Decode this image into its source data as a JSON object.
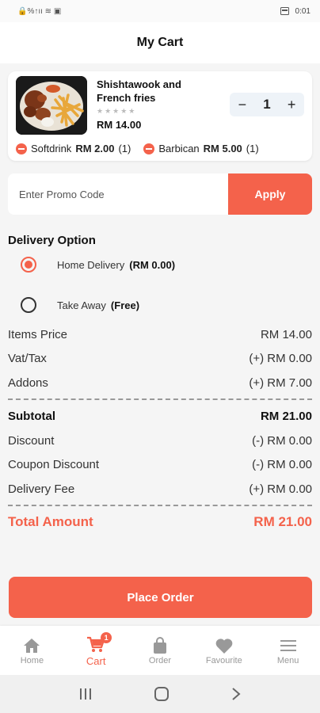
{
  "status_bar": {
    "left_icons": "🔒%↑ıı ≋ ▣",
    "time": "0:01"
  },
  "header": {
    "title": "My Cart"
  },
  "cart_item": {
    "name": "Shishtawook and French fries",
    "rating": "★★★★★",
    "price": "RM 14.00",
    "quantity": "1",
    "addons": [
      {
        "name": "Softdrink",
        "price": "RM 2.00",
        "qty": "(1)"
      },
      {
        "name": "Barbican",
        "price": "RM 5.00",
        "qty": "(1)"
      }
    ]
  },
  "promo": {
    "placeholder": "Enter Promo Code",
    "apply_label": "Apply"
  },
  "delivery": {
    "title": "Delivery Option",
    "options": [
      {
        "label": "Home Delivery",
        "sub": "(RM 0.00)",
        "selected": true
      },
      {
        "label": "Take Away",
        "sub": "(Free)",
        "selected": false
      }
    ]
  },
  "summary": {
    "items_price": {
      "label": "Items Price",
      "value": "RM 14.00"
    },
    "vat": {
      "label": "Vat/Tax",
      "value": "(+) RM 0.00"
    },
    "addons": {
      "label": "Addons",
      "value": "(+) RM 7.00"
    },
    "subtotal": {
      "label": "Subtotal",
      "value": "RM 21.00"
    },
    "discount": {
      "label": "Discount",
      "value": "(-) RM 0.00"
    },
    "coupon": {
      "label": "Coupon Discount",
      "value": "(-) RM 0.00"
    },
    "delivery_fee": {
      "label": "Delivery Fee",
      "value": "(+) RM 0.00"
    },
    "total": {
      "label": "Total Amount",
      "value": "RM 21.00"
    }
  },
  "place_order_label": "Place Order",
  "nav": [
    {
      "label": "Home",
      "icon": "home-icon"
    },
    {
      "label": "Cart",
      "icon": "cart-icon",
      "badge": "1",
      "active": true
    },
    {
      "label": "Order",
      "icon": "bag-icon"
    },
    {
      "label": "Favourite",
      "icon": "heart-icon"
    },
    {
      "label": "Menu",
      "icon": "menu-icon"
    }
  ],
  "colors": {
    "accent": "#f4624b",
    "background": "#f5f5f5",
    "nav_inactive": "#999999"
  }
}
